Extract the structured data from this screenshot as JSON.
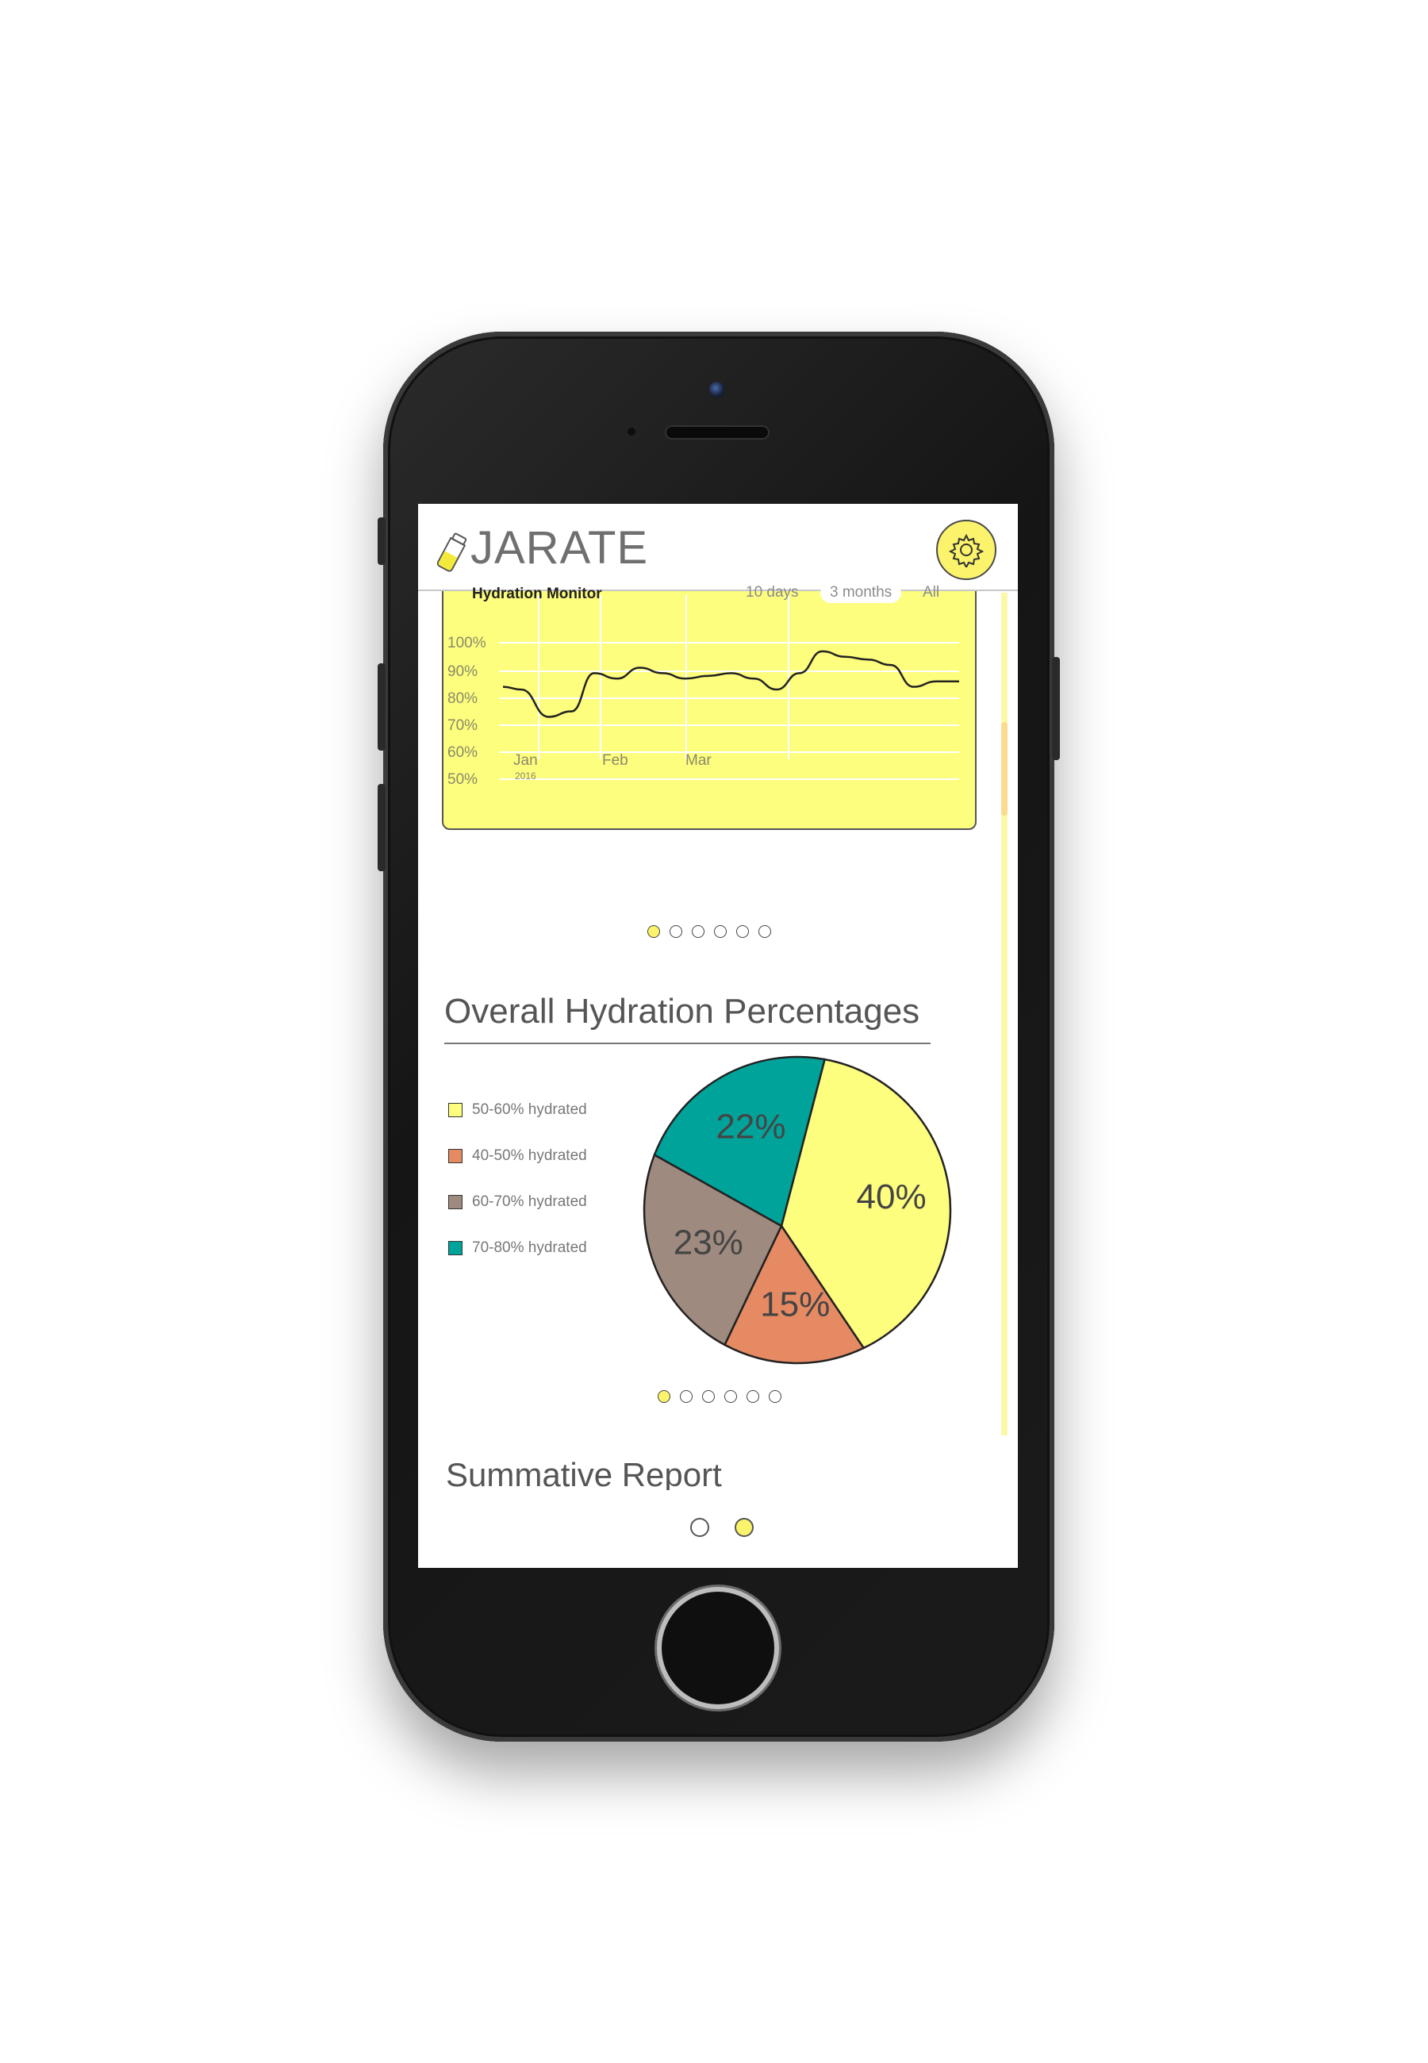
{
  "app": {
    "title": "JARATE"
  },
  "monitor": {
    "title": "Hydration Monitor",
    "ranges": [
      "10 days",
      "3 months",
      "All"
    ],
    "active_range": "3 months"
  },
  "chart_data": [
    {
      "type": "line",
      "title": "Hydration Monitor",
      "y_ticks": [
        "100%",
        "90%",
        "80%",
        "70%",
        "60%",
        "50%"
      ],
      "x_ticks": [
        "Jan",
        "Feb",
        "Mar"
      ],
      "x_sublabel": "2016",
      "ylim": [
        50,
        100
      ],
      "grid": true,
      "series": [
        {
          "x": [
            0,
            4,
            10,
            15,
            20,
            25,
            30,
            35,
            40,
            45,
            50,
            55,
            60,
            65,
            70,
            75,
            80,
            85,
            90,
            95,
            100
          ],
          "values": [
            85,
            84,
            74,
            76,
            90,
            88,
            92,
            90,
            88,
            89,
            90,
            88,
            84,
            90,
            98,
            96,
            95,
            93,
            85,
            87,
            87
          ]
        }
      ]
    },
    {
      "type": "pie",
      "title": "Overall Hydration Percentages",
      "legend": [
        "50-60% hydrated",
        "40-50% hydrated",
        "60-70% hydrated",
        "70-80% hydrated"
      ],
      "slices": [
        {
          "label": "50-60% hydrated",
          "value": 40,
          "display": "40%",
          "color": "#fdfd7e"
        },
        {
          "label": "40-50% hydrated",
          "value": 15,
          "display": "15%",
          "color": "#e58a63"
        },
        {
          "label": "60-70% hydrated",
          "value": 23,
          "display": "23%",
          "color": "#9e8a7e"
        },
        {
          "label": "70-80% hydrated",
          "value": 22,
          "display": "22%",
          "color": "#00a39a"
        }
      ]
    }
  ],
  "carousel1": {
    "count": 6,
    "active": 0
  },
  "carousel2": {
    "count": 6,
    "active": 0
  },
  "pager": {
    "count": 2,
    "active": 1
  },
  "sections": {
    "hydration_title": "Overall Hydration Percentages",
    "summative_title": "Summative Report"
  },
  "colors": {
    "accent": "#fbf36b",
    "card": "#fdfd7e",
    "teal": "#00a39a",
    "coral": "#e58a63",
    "taupe": "#9e8a7e"
  }
}
